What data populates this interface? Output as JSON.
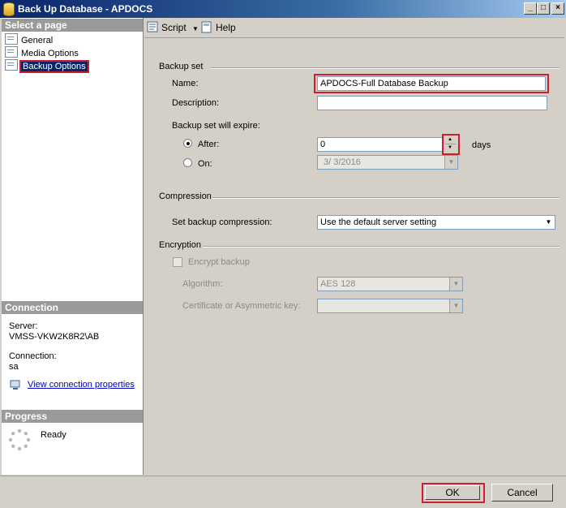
{
  "window": {
    "title": "Back Up Database - APDOCS"
  },
  "left_panel": {
    "select_page_header": "Select a page",
    "pages": [
      {
        "label": "General"
      },
      {
        "label": "Media Options"
      },
      {
        "label": "Backup Options"
      }
    ],
    "connection_header": "Connection",
    "server_label": "Server:",
    "server_value": "VMSS-VKW2K8R2\\AB",
    "connection_label": "Connection:",
    "connection_value": "sa",
    "view_connection_link": "View connection properties",
    "progress_header": "Progress",
    "progress_status": "Ready"
  },
  "toolbar": {
    "script_label": "Script",
    "help_label": "Help"
  },
  "backup_set": {
    "group_label": "Backup set",
    "name_label": "Name:",
    "name_value": "APDOCS-Full Database Backup",
    "description_label": "Description:",
    "description_value": "",
    "expire_label": "Backup set will expire:",
    "after_label": "After:",
    "after_value": "0",
    "days_label": "days",
    "on_label": "On:",
    "on_value": "3/  3/2016"
  },
  "compression": {
    "group_label": "Compression",
    "set_label": "Set backup compression:",
    "selected": "Use the default server setting"
  },
  "encryption": {
    "group_label": "Encryption",
    "encrypt_label": "Encrypt backup",
    "algorithm_label": "Algorithm:",
    "algorithm_value": "AES 128",
    "cert_label": "Certificate or Asymmetric key:",
    "cert_value": ""
  },
  "buttons": {
    "ok": "OK",
    "cancel": "Cancel"
  },
  "colors": {
    "highlight_red": "#cc1f2b",
    "title_blue": "#0a246a"
  }
}
